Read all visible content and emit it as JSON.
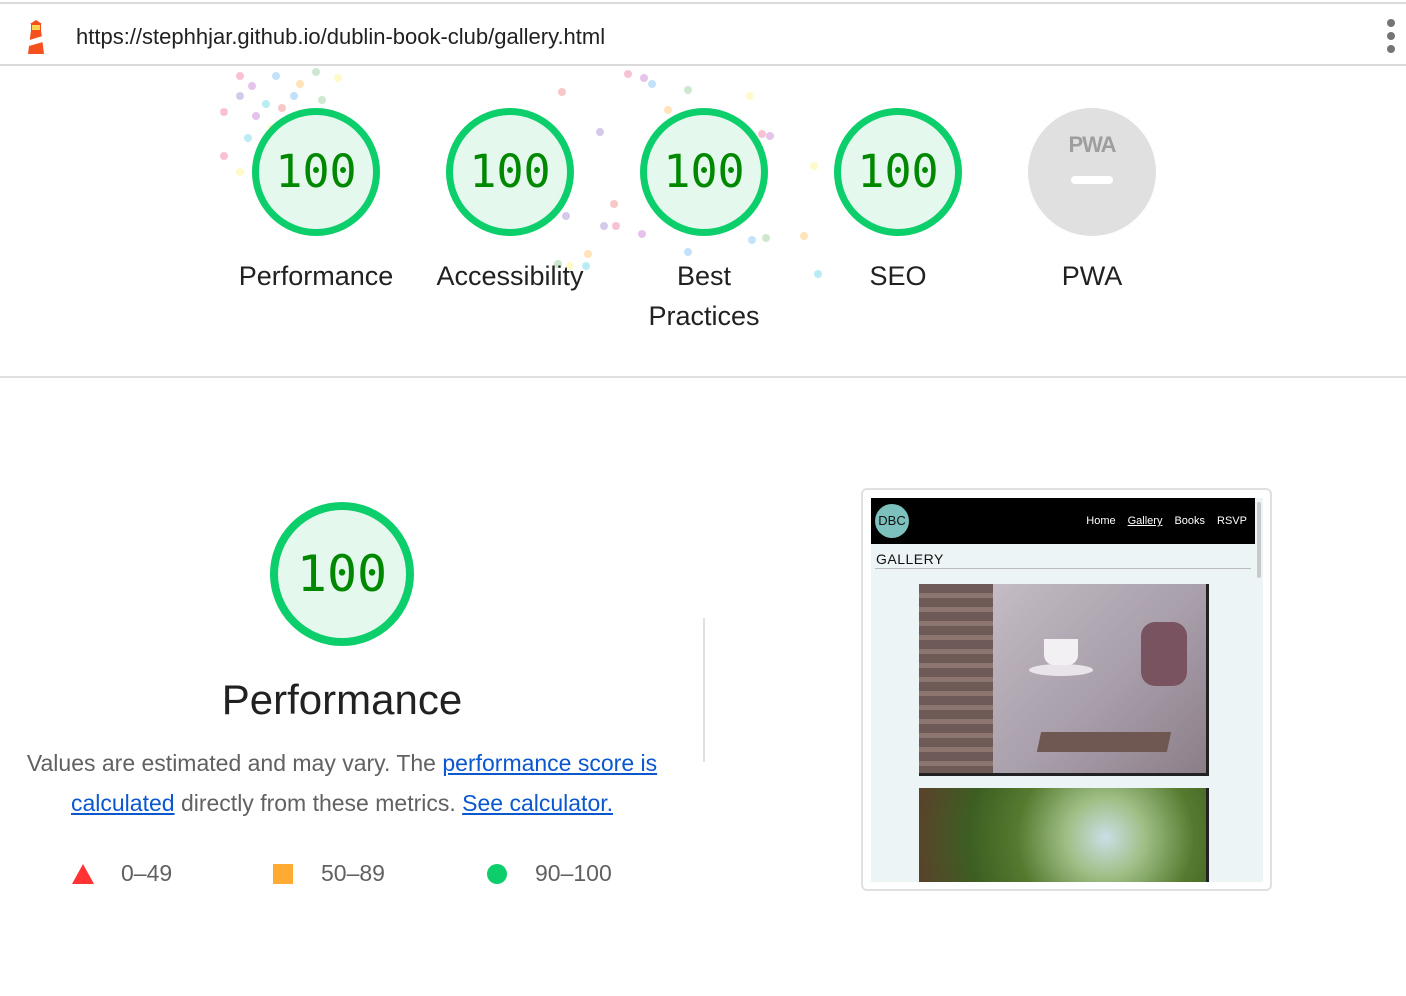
{
  "toolbar": {
    "url": "https://stephhjar.github.io/dublin-book-club/gallery.html",
    "logo_icon": "lighthouse-icon",
    "menu_icon": "kebab-menu-icon"
  },
  "scores": [
    {
      "label": "Performance",
      "value": "100"
    },
    {
      "label": "Accessibility",
      "value": "100"
    },
    {
      "label": "Best\nPractices",
      "value": "100"
    },
    {
      "label": "SEO",
      "value": "100"
    }
  ],
  "pwa": {
    "label": "PWA",
    "badge": "PWA"
  },
  "performance": {
    "score": "100",
    "title": "Performance",
    "desc_text_1": "Values are estimated and may vary. The ",
    "desc_link_1": "performance score is calculated",
    "desc_text_2": " directly from these metrics. ",
    "desc_link_2": "See calculator."
  },
  "legend": {
    "fail": "0–49",
    "average": "50–89",
    "pass": "90–100"
  },
  "screenshot": {
    "logo": "DBC",
    "nav": [
      "Home",
      "Gallery",
      "Books",
      "RSVP"
    ],
    "heading": "GALLERY"
  },
  "colors": {
    "pass": "#0cce6b",
    "pass_text": "#008800",
    "average": "#ffaa33",
    "fail": "#ff3333",
    "link": "#0b57d0"
  }
}
